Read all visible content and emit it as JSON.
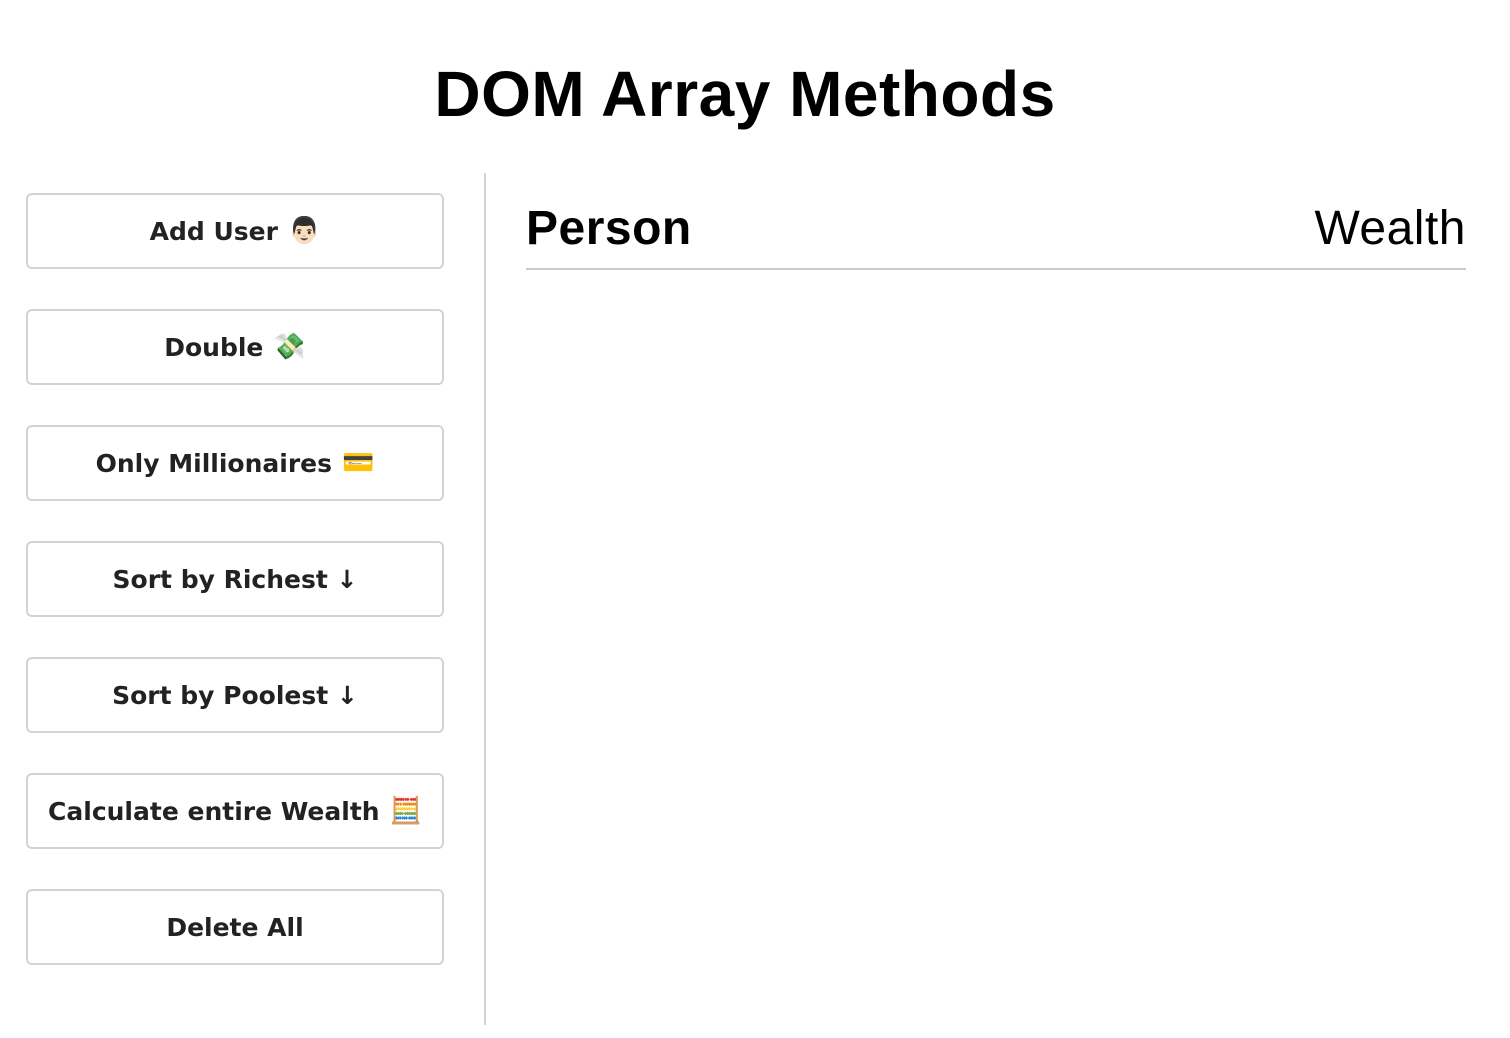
{
  "header": {
    "title": "DOM Array Methods"
  },
  "sidebar": {
    "buttons": [
      {
        "label": "Add User",
        "emoji": "👨🏻"
      },
      {
        "label": "Double",
        "emoji": "💸"
      },
      {
        "label": "Only Millionaires",
        "emoji": "💳"
      },
      {
        "label": "Sort by Richest ↓",
        "emoji": ""
      },
      {
        "label": "Sort by Poolest ↓",
        "emoji": ""
      },
      {
        "label": "Calculate entire Wealth",
        "emoji": "🧮"
      },
      {
        "label": "Delete All",
        "emoji": ""
      }
    ]
  },
  "main": {
    "columns": {
      "person": "Person",
      "wealth": "Wealth"
    },
    "rows": []
  }
}
